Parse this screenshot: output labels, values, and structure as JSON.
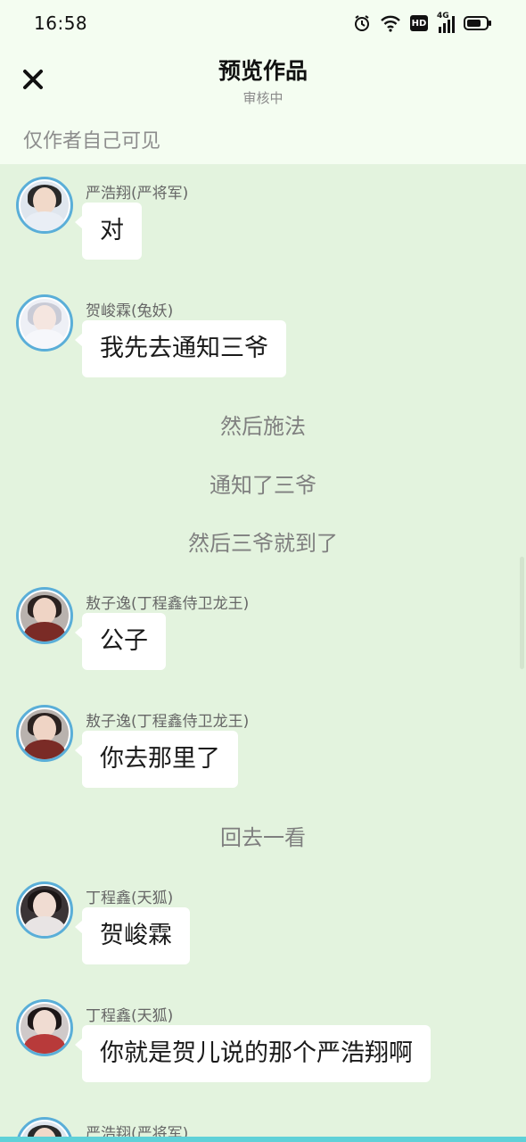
{
  "status_bar": {
    "time": "16:58",
    "icons": [
      "alarm-icon",
      "wifi-icon",
      "hd-badge",
      "signal-4g-icon",
      "battery-icon"
    ],
    "hd_label": "HD",
    "network_label": "4G"
  },
  "header": {
    "close_icon": "close-icon",
    "title": "预览作品",
    "subtitle": "审核中"
  },
  "visibility_note": "仅作者自己可见",
  "colors": {
    "background": "#e3f3de",
    "header_bg": "#f4fdf1",
    "avatar_ring": "#5aaed8",
    "bubble": "#ffffff",
    "narration_text": "#7f7f7f"
  },
  "messages": [
    {
      "type": "chat",
      "sender": "严浩翔(严将军)",
      "text": "对"
    },
    {
      "type": "chat",
      "sender": "贺峻霖(兔妖)",
      "text": "我先去通知三爷"
    },
    {
      "type": "narration",
      "text": "然后施法"
    },
    {
      "type": "narration",
      "text": "通知了三爷"
    },
    {
      "type": "narration",
      "text": "然后三爷就到了"
    },
    {
      "type": "chat",
      "sender": "敖子逸(丁程鑫侍卫龙王)",
      "text": "公子"
    },
    {
      "type": "chat",
      "sender": "敖子逸(丁程鑫侍卫龙王)",
      "text": "你去那里了"
    },
    {
      "type": "narration",
      "text": "回去一看"
    },
    {
      "type": "chat",
      "sender": "丁程鑫(天狐)",
      "text": "贺峻霖"
    },
    {
      "type": "chat",
      "sender": "丁程鑫(天狐)",
      "text": "你就是贺儿说的那个严浩翔啊"
    },
    {
      "type": "chat",
      "sender": "严浩翔(严将军)",
      "text": ""
    }
  ]
}
